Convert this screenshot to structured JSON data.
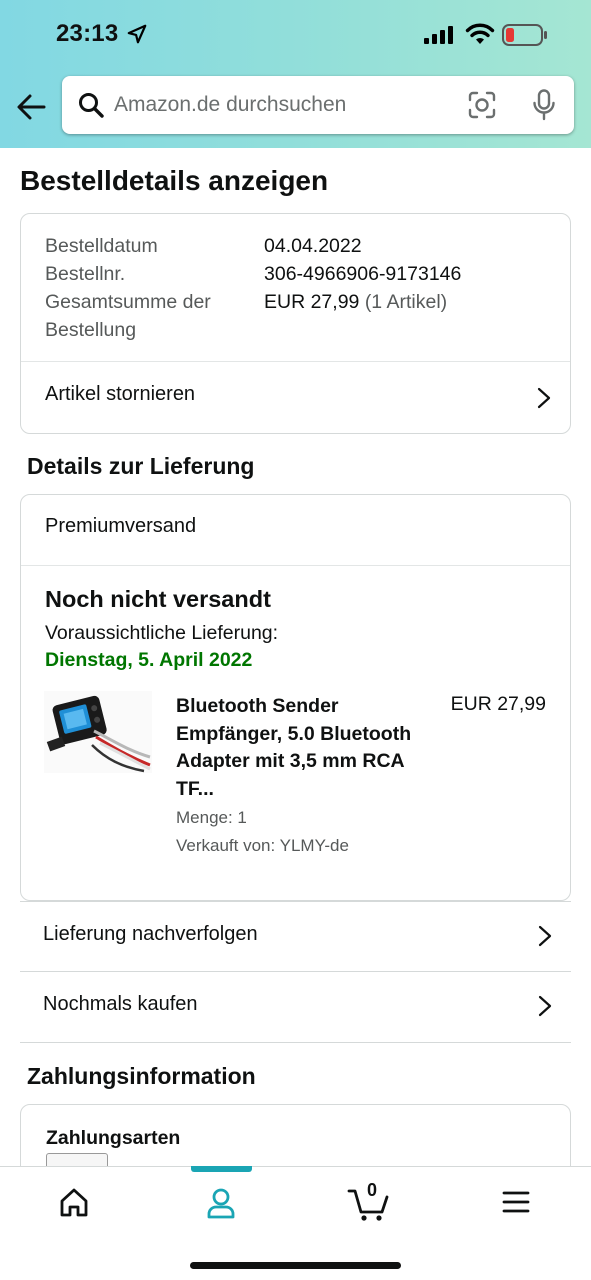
{
  "status_bar": {
    "time": "23:13",
    "icons": [
      "location-arrow-icon",
      "cellular-signal-icon",
      "wifi-icon",
      "battery-low-icon"
    ],
    "battery_color": "#e53935"
  },
  "header": {
    "back_icon": "arrow-left-icon",
    "search": {
      "placeholder": "Amazon.de durchsuchen",
      "value": ""
    },
    "icons": [
      "search-icon",
      "camera-scan-icon",
      "microphone-icon"
    ]
  },
  "page": {
    "title": "Bestelldetails anzeigen"
  },
  "order_summary": {
    "rows": [
      {
        "label": "Bestelldatum",
        "value": "04.04.2022"
      },
      {
        "label": "Bestellnr.",
        "value": "306-4966906-9173146"
      },
      {
        "label": "Gesamtsumme der",
        "label_line2": "Bestellung",
        "value": "EUR 27,99",
        "value_suffix": "(1 Artikel)"
      }
    ],
    "cancel_label": "Artikel stornieren"
  },
  "delivery": {
    "section_title": "Details zur Lieferung",
    "shipping_method": "Premiumversand",
    "status": "Noch nicht versandt",
    "estimated_label": "Voraussichtliche Lieferung:",
    "estimated_date": "Dienstag, 5. April 2022",
    "estimated_date_color": "#007600",
    "item": {
      "title": "Bluetooth Sender Empfänger, 5.0 Bluetooth Adapter mit 3,5 mm RCA TF...",
      "price": "EUR 27,99",
      "quantity": "Menge: 1",
      "seller": "Verkauft von: YLMY-de"
    }
  },
  "actions": [
    {
      "label": "Lieferung nachverfolgen"
    },
    {
      "label": "Nochmals kaufen"
    }
  ],
  "payment": {
    "section_title": "Zahlungsinformation",
    "methods_label": "Zahlungsarten"
  },
  "bottom_nav": {
    "items": [
      {
        "name": "home",
        "icon": "home-icon"
      },
      {
        "name": "account",
        "icon": "person-icon",
        "active": true
      },
      {
        "name": "cart",
        "icon": "cart-icon",
        "count": "0"
      },
      {
        "name": "menu",
        "icon": "hamburger-menu-icon"
      }
    ],
    "accent_color": "#1aa5b4"
  }
}
